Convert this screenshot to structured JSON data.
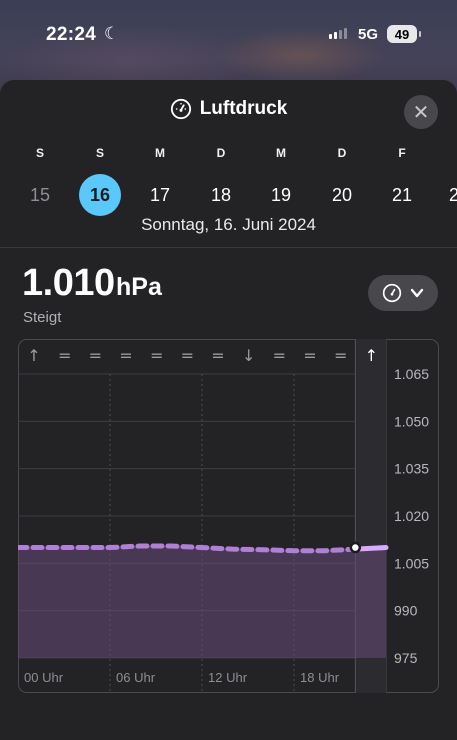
{
  "status_bar": {
    "time": "22:24",
    "network": "5G",
    "battery": "49"
  },
  "header": {
    "title": "Luftdruck",
    "close_icon": "close-icon",
    "title_icon": "gauge-icon"
  },
  "days": [
    {
      "letter": "S",
      "num": "15",
      "state": "past"
    },
    {
      "letter": "S",
      "num": "16",
      "state": "selected"
    },
    {
      "letter": "M",
      "num": "17",
      "state": "future"
    },
    {
      "letter": "D",
      "num": "18",
      "state": "future"
    },
    {
      "letter": "M",
      "num": "19",
      "state": "future"
    },
    {
      "letter": "D",
      "num": "20",
      "state": "future"
    },
    {
      "letter": "F",
      "num": "21",
      "state": "future"
    },
    {
      "letter": "",
      "num": "2",
      "state": "future"
    }
  ],
  "date_label": "Sonntag, 16. Juni 2024",
  "reading": {
    "value": "1.010",
    "unit": "hPa",
    "trend": "Steigt"
  },
  "colors": {
    "selected_day": "#5ac8fa",
    "line": "#b07fd6",
    "line_now": "#d9a8ff",
    "fill": "#6a4a78"
  },
  "chart_data": {
    "type": "area",
    "ylim": [
      975,
      1065
    ],
    "y_ticks": [
      "1.065",
      "1.050",
      "1.035",
      "1.020",
      "1.005",
      "990",
      "975"
    ],
    "x_ticks": [
      "00 Uhr",
      "06 Uhr",
      "12 Uhr",
      "18 Uhr"
    ],
    "trend_arrows": [
      "↑",
      "=",
      "=",
      "=",
      "=",
      "=",
      "=",
      "↓",
      "=",
      "=",
      "=",
      "↑"
    ],
    "x_hours": [
      0,
      2,
      4,
      6,
      8,
      10,
      12,
      14,
      16,
      18,
      20,
      22,
      24
    ],
    "values": [
      1010,
      1010,
      1010,
      1010,
      1010.5,
      1010.5,
      1010,
      1009.5,
      1009.3,
      1009,
      1009,
      1009.5,
      1010
    ],
    "now_hour": 22,
    "now_value": 1010
  }
}
